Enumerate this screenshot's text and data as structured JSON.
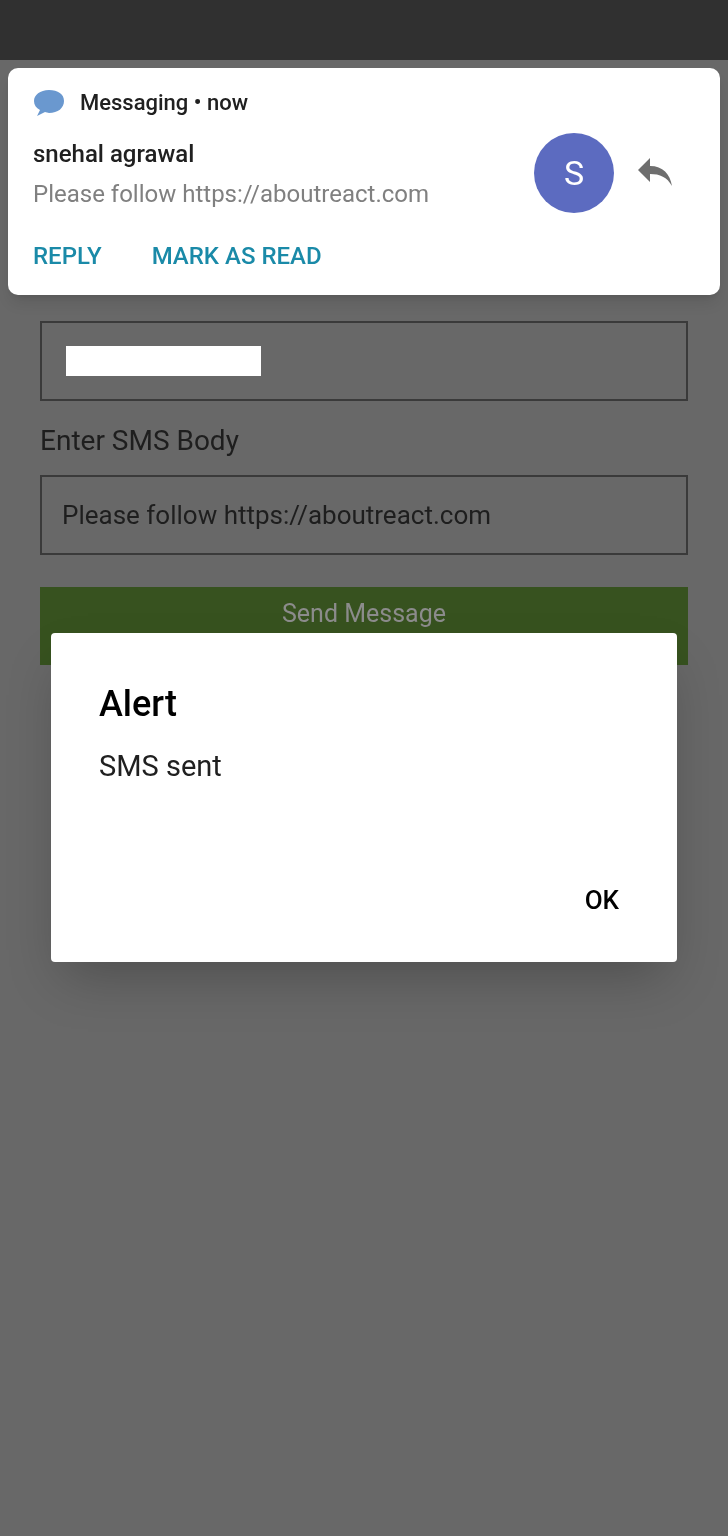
{
  "notification": {
    "app": "Messaging",
    "separator": "•",
    "time": "now",
    "sender": "snehal agrawal",
    "message": "Please follow https://aboutreact.com",
    "avatar_letter": "S",
    "actions": [
      "REPLY",
      "MARK AS READ"
    ]
  },
  "form": {
    "fields": [
      {
        "kind": "redacted"
      },
      {
        "kind": "text",
        "label": "Enter SMS Body",
        "value": "Please follow https://aboutreact.com"
      }
    ],
    "button": "Send Message"
  },
  "dialog": {
    "title": "Alert",
    "message": "SMS sent",
    "buttons": [
      "OK"
    ]
  }
}
